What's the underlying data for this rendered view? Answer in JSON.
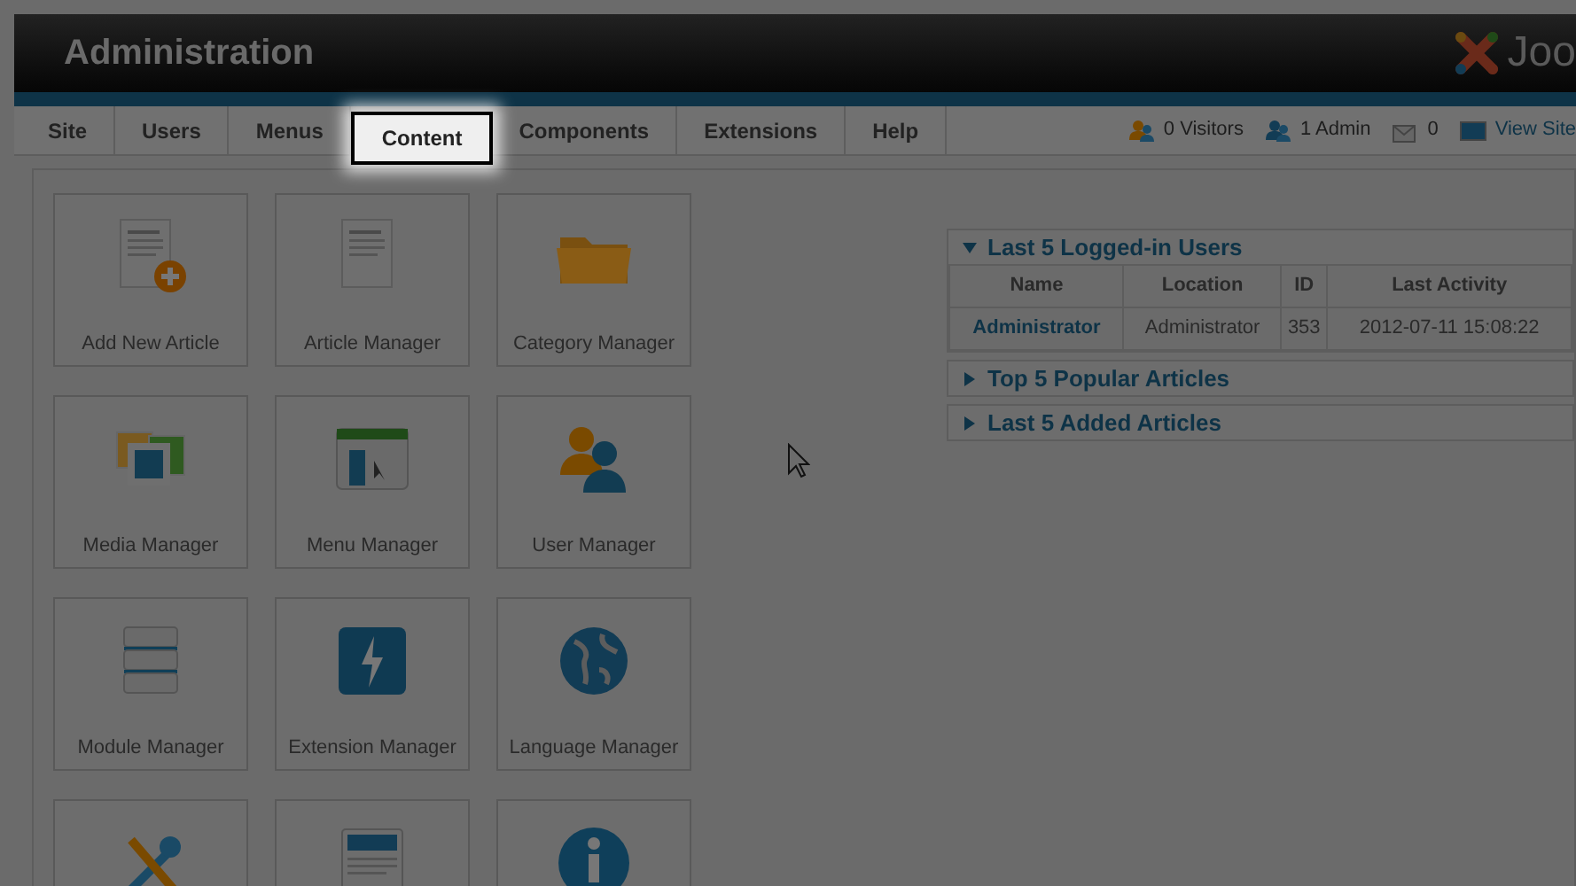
{
  "header": {
    "title": "Administration",
    "logo_text": "Joo"
  },
  "tabs": [
    {
      "label": "Site",
      "selected": false
    },
    {
      "label": "Users",
      "selected": false
    },
    {
      "label": "Menus",
      "selected": false
    },
    {
      "label": "Content",
      "selected": true
    },
    {
      "label": "Components",
      "selected": false
    },
    {
      "label": "Extensions",
      "selected": false
    },
    {
      "label": "Help",
      "selected": false
    }
  ],
  "status": [
    {
      "kind": "visitors",
      "label": "0 Visitors"
    },
    {
      "kind": "admins",
      "label": "1 Admin"
    },
    {
      "kind": "messages",
      "label": "0"
    },
    {
      "kind": "view",
      "label": "View Site"
    }
  ],
  "quick_icons": [
    {
      "kind": "add-article",
      "label": "Add New Article"
    },
    {
      "kind": "article",
      "label": "Article Manager"
    },
    {
      "kind": "folder",
      "label": "Category Manager"
    },
    {
      "kind": "media",
      "label": "Media Manager"
    },
    {
      "kind": "menu",
      "label": "Menu Manager"
    },
    {
      "kind": "users",
      "label": "User Manager"
    },
    {
      "kind": "module",
      "label": "Module Manager"
    },
    {
      "kind": "extension",
      "label": "Extension Manager"
    },
    {
      "kind": "globe",
      "label": "Language Manager"
    },
    {
      "kind": "tools"
    },
    {
      "kind": "template"
    },
    {
      "kind": "info"
    }
  ],
  "panels": [
    {
      "title": "Last 5 Logged-in Users",
      "expanded": true,
      "table": {
        "columns": [
          "Name",
          "Location",
          "ID",
          "Last Activity"
        ],
        "rows": [
          [
            "Administrator",
            "Administrator",
            "353",
            "2012-07-11 15:08:22"
          ]
        ]
      }
    },
    {
      "title": "Top 5 Popular Articles",
      "expanded": false
    },
    {
      "title": "Last 5 Added Articles",
      "expanded": false
    }
  ]
}
